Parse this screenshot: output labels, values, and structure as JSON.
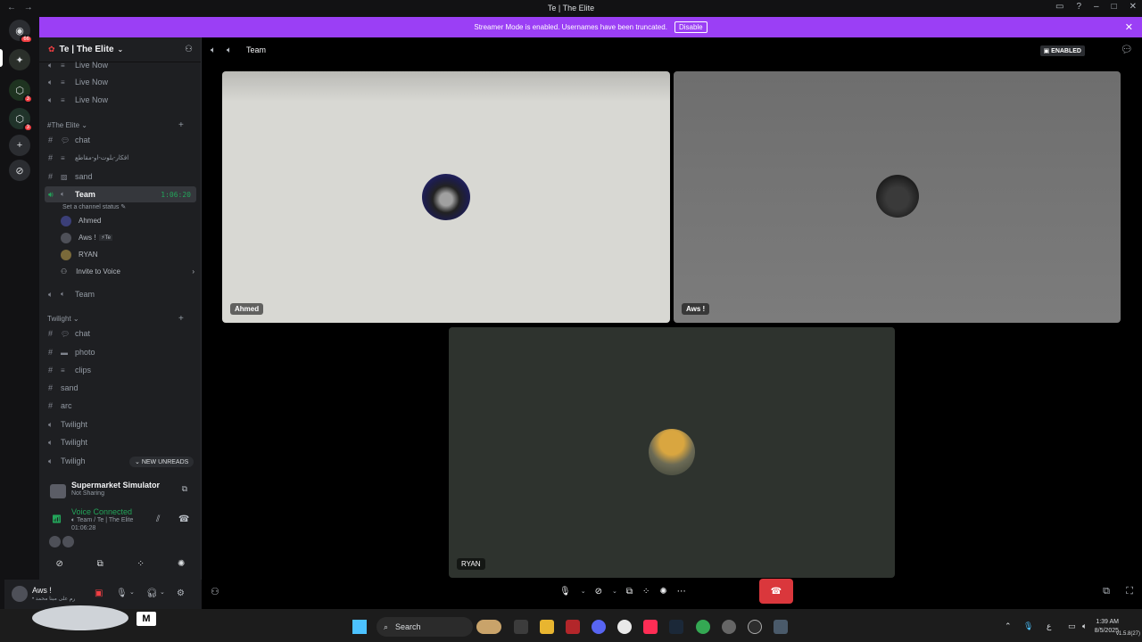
{
  "titlebar": {
    "title": "Te | The Elite",
    "nav_back": "←",
    "nav_forward": "→"
  },
  "banner": {
    "text": "Streamer Mode is enabled. Usernames have been truncated.",
    "button": "Disable"
  },
  "server": {
    "name": "Te | The Elite"
  },
  "rail": {
    "badges": [
      "66",
      "3",
      "3"
    ]
  },
  "sidebar": {
    "top_channels": [
      {
        "label": "Live Now"
      },
      {
        "label": "Live Now"
      },
      {
        "label": "Live Now"
      }
    ],
    "category1": "#The Elite",
    "category1_channels": [
      {
        "label": "chat"
      },
      {
        "label": "افكار-بلوت-او-مقاطع"
      },
      {
        "label": "sand"
      }
    ],
    "active_channel": {
      "label": "Team",
      "time": "1:06:20",
      "status": "Set a channel status"
    },
    "voice_users": [
      "Ahmed",
      "Aws !",
      "RYAN"
    ],
    "voice_user_tag": "Te",
    "invite": "Invite to Voice",
    "second_team": "Team",
    "category2": "Twilight",
    "category2_channels": [
      {
        "label": "chat"
      },
      {
        "label": "photo"
      },
      {
        "label": "clips"
      },
      {
        "label": "sand"
      },
      {
        "label": "arc"
      },
      {
        "label": "Twilight"
      },
      {
        "label": "Twilight"
      },
      {
        "label": "Twiligh"
      }
    ],
    "new_unreads": "NEW UNREADS"
  },
  "activity": {
    "game": "Supermarket Simulator",
    "status": "Not Sharing"
  },
  "voice": {
    "connected": "Voice Connected",
    "location": "Team / Te | The Elite",
    "duration": "01:06:28"
  },
  "user": {
    "name": "Aws !",
    "status": "• رم على مبنا محمد"
  },
  "main": {
    "channel": "Team",
    "enabled_badge": "ENABLED",
    "tiles": [
      {
        "name": "Ahmed",
        "bg": "#d8d8d3"
      },
      {
        "name": "Aws !",
        "bg": "#7c7c7c"
      },
      {
        "name": "RYAN",
        "bg": "#2e332e"
      }
    ]
  },
  "taskbar": {
    "m_label": "M",
    "search": "Search",
    "clock_time": "1:39 AM",
    "clock_date": "8/5/2025",
    "lang": "ع",
    "version": "v1.5.8(27)"
  },
  "colors": {
    "accent": "#9b3ff5",
    "connected": "#23a55a",
    "danger": "#da373c"
  }
}
